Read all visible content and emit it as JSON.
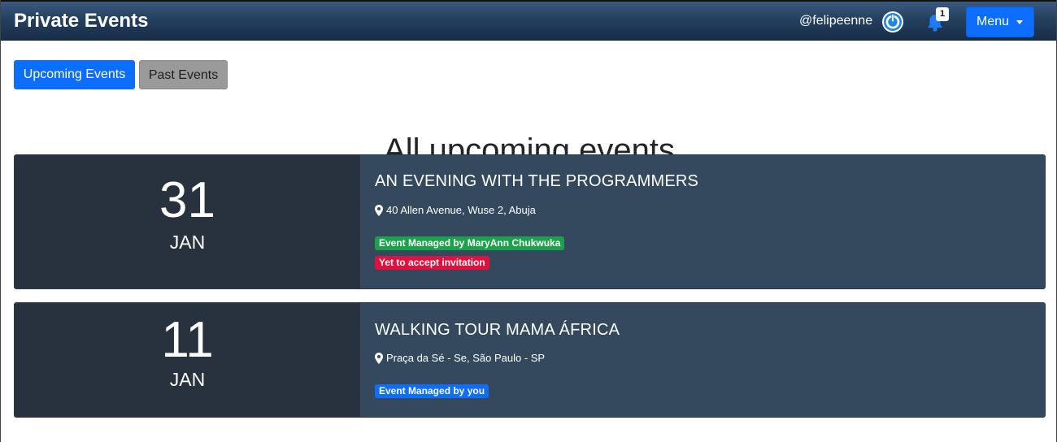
{
  "navbar": {
    "brand": "Private Events",
    "username": "@felipeenne",
    "notification_count": "1",
    "menu_label": "Menu"
  },
  "tabs": [
    {
      "label": "Upcoming Events",
      "active": true
    },
    {
      "label": "Past Events",
      "active": false
    }
  ],
  "page_title": "All upcoming events",
  "events": [
    {
      "day": "31",
      "month": "JAN",
      "title": "AN EVENING WITH THE PROGRAMMERS",
      "location": "40 Allen Avenue, Wuse 2, Abuja",
      "badges": [
        {
          "text": "Event Managed by MaryAnn Chukwuka",
          "color": "#1aa34a"
        },
        {
          "text": "Yet to accept invitation",
          "color": "#e0113e"
        }
      ]
    },
    {
      "day": "11",
      "month": "JAN",
      "title": "WALKING TOUR MAMA ÁFRICA",
      "location": "Praça da Sé - Se, São Paulo - SP",
      "badges": [
        {
          "text": "Event Managed by you",
          "color": "#0d6efd"
        }
      ]
    }
  ],
  "icons": {
    "power": "power-icon",
    "bell": "bell-icon",
    "pin": "map-pin-icon",
    "caret": "caret-down-icon"
  },
  "colors": {
    "primary": "#0d6efd",
    "card_bg": "#34495e",
    "date_bg": "#28323e",
    "secondary_button": "#9a9a9a"
  }
}
